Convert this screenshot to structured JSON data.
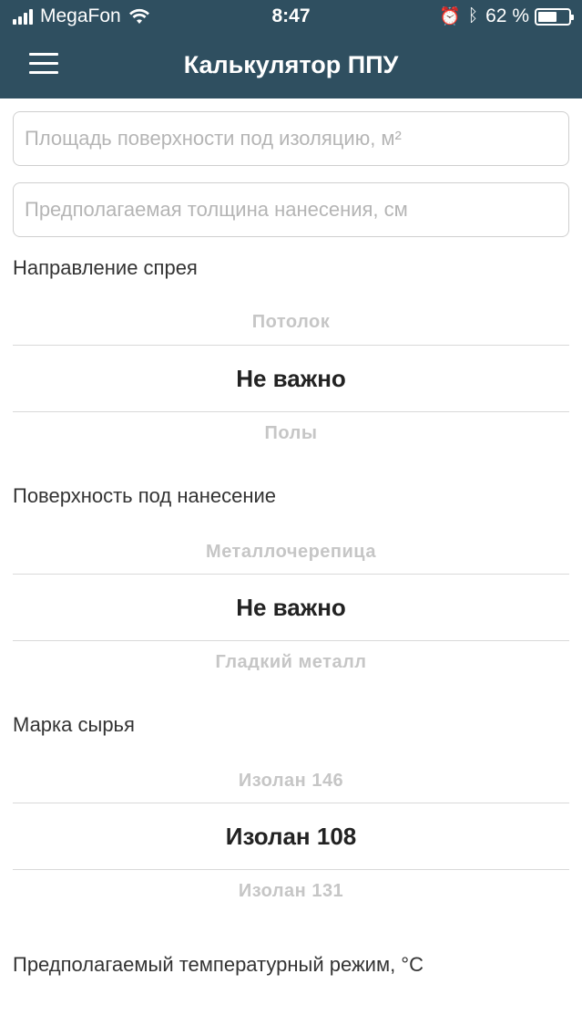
{
  "status_bar": {
    "carrier": "MegaFon",
    "time": "8:47",
    "battery_percent": "62 %",
    "battery_level": 0.62
  },
  "nav": {
    "title": "Калькулятор ППУ"
  },
  "fields": {
    "area_placeholder": "Площадь поверхности под изоляцию, м²",
    "thickness_placeholder": "Предполагаемая толщина нанесения, см"
  },
  "pickers": [
    {
      "label": "Направление спрея",
      "above": "Потолок",
      "selected": "Не важно",
      "below": "Полы"
    },
    {
      "label": "Поверхность под нанесение",
      "above": "Металлочерепица",
      "selected": "Не важно",
      "below": "Гладкий металл"
    },
    {
      "label": "Марка сырья",
      "above": "Изолан 146",
      "selected": "Изолан 108",
      "below": "Изолан 131"
    }
  ],
  "temperature_label": "Предполагаемый температурный режим, °C"
}
